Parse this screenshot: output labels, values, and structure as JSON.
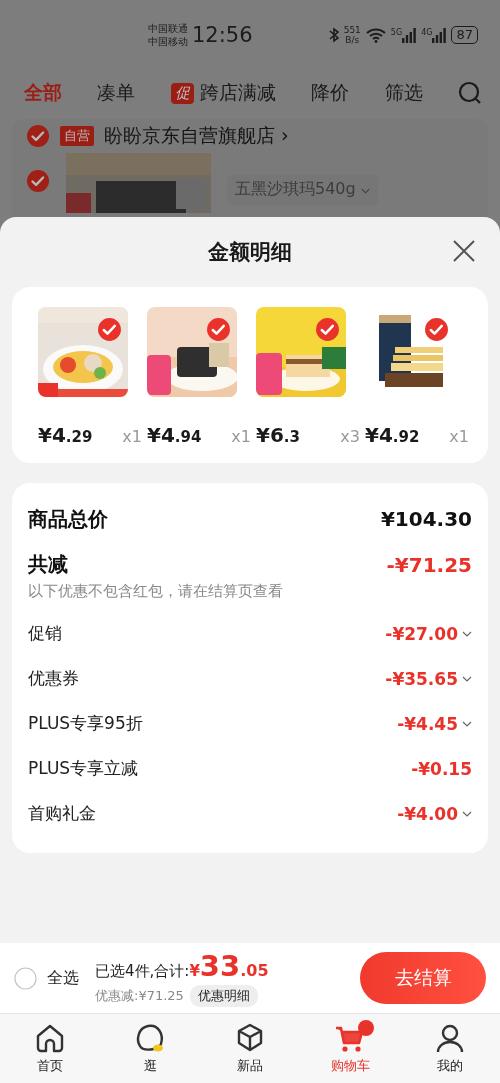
{
  "status_bar": {
    "carriers": [
      "中国联通",
      "中国移动"
    ],
    "time": "12:56",
    "net_speed": [
      "551",
      "B/s"
    ],
    "signals": [
      "5G",
      "4G"
    ],
    "battery": "87"
  },
  "filter_tabs": [
    {
      "label": "全部",
      "selected": true
    },
    {
      "label": "凑单",
      "selected": false
    },
    {
      "label": "跨店满减",
      "selected": false,
      "badge": "促"
    },
    {
      "label": "降价",
      "selected": false
    },
    {
      "label": "筛选",
      "selected": false
    }
  ],
  "store": {
    "tag": "自营",
    "name": "盼盼京东自营旗舰店",
    "chevron": "›",
    "checked": true
  },
  "cart_item": {
    "variant": "五黑沙琪玛540g",
    "checked": true
  },
  "sheet": {
    "title": "金额明细",
    "products": [
      {
        "price_main": "¥4",
        "price_fraction": ".29",
        "quantity": "x1",
        "checked": true
      },
      {
        "price_main": "¥4",
        "price_fraction": ".94",
        "quantity": "x1",
        "checked": true
      },
      {
        "price_main": "¥6",
        "price_fraction": ".3",
        "quantity": "x3",
        "checked": true
      },
      {
        "price_main": "¥4",
        "price_fraction": ".92",
        "quantity": "x1",
        "checked": true
      }
    ],
    "total": {
      "label": "商品总价",
      "value": "¥104.30"
    },
    "discount": {
      "label": "共减",
      "value": "-¥71.25",
      "note": "以下优惠不包含红包，请在结算页查看"
    },
    "discount_rows": [
      {
        "label": "促销",
        "value": "-¥27.00",
        "expandable": true
      },
      {
        "label": "优惠券",
        "value": "-¥35.65",
        "expandable": true
      },
      {
        "label": "PLUS专享95折",
        "value": "-¥4.45",
        "expandable": true
      },
      {
        "label": "PLUS专享立减",
        "value": "-¥0.15",
        "expandable": false
      },
      {
        "label": "首购礼金",
        "value": "-¥4.00",
        "expandable": true
      }
    ]
  },
  "checkout_bar": {
    "select_all": {
      "label": "全选",
      "checked": false
    },
    "summary": "已选4件,合计:",
    "currency": "¥",
    "total_main": "33",
    "total_fraction": ".05",
    "saving": "优惠减:¥71.25",
    "detail_button": "优惠明细",
    "checkout_button": "去结算"
  },
  "tab_bar": [
    {
      "label": "首页",
      "kind": "home",
      "selected": false
    },
    {
      "label": "逛",
      "kind": "explore",
      "selected": false
    },
    {
      "label": "新品",
      "kind": "new",
      "selected": false
    },
    {
      "label": "购物车",
      "kind": "cart",
      "selected": true,
      "badge": true
    },
    {
      "label": "我的",
      "kind": "me",
      "selected": false
    }
  ]
}
